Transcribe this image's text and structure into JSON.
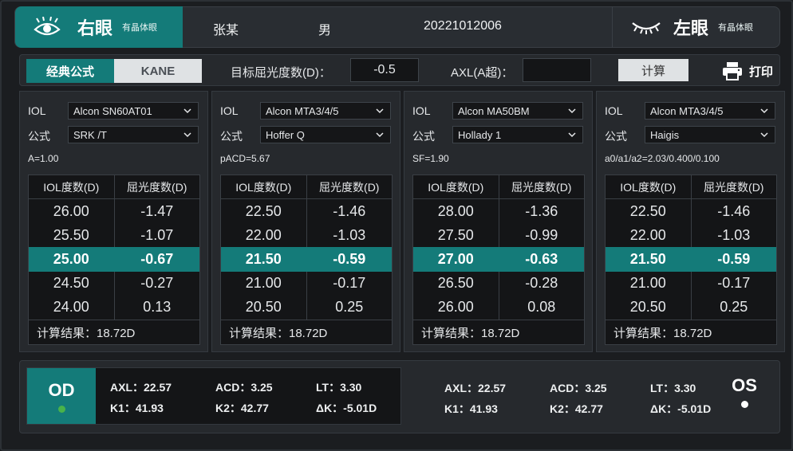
{
  "header": {
    "right_eye_label": "右眼",
    "right_eye_sub": "有晶体眼",
    "patient_name": "张某",
    "gender": "男",
    "patient_id": "20221012006",
    "left_eye_label": "左眼",
    "left_eye_sub": "有晶体眼"
  },
  "toolbar": {
    "tab_classic": "经典公式",
    "tab_kane": "KANE",
    "target_label": "目标屈光度数(D)：",
    "target_value": "-0.5",
    "axl_label": "AXL(A超)：",
    "axl_value": "",
    "calc_label": "计算",
    "print_label": "打印"
  },
  "cards": [
    {
      "iol_label": "IOL",
      "iol_value": "Alcon SN60AT01",
      "formula_label": "公式",
      "formula_value": "SRK /T",
      "param": "A=1.00",
      "col1": "IOL度数(D)",
      "col2": "屈光度数(D)",
      "rows": [
        {
          "iol": "26.00",
          "ref": "-1.47"
        },
        {
          "iol": "25.50",
          "ref": "-1.07"
        },
        {
          "iol": "25.00",
          "ref": "-0.67"
        },
        {
          "iol": "24.50",
          "ref": "-0.27"
        },
        {
          "iol": "24.00",
          "ref": "0.13"
        }
      ],
      "result": "计算结果：18.72D"
    },
    {
      "iol_label": "IOL",
      "iol_value": "Alcon MTA3/4/5",
      "formula_label": "公式",
      "formula_value": "Hoffer Q",
      "param": "pACD=5.67",
      "col1": "IOL度数(D)",
      "col2": "屈光度数(D)",
      "rows": [
        {
          "iol": "22.50",
          "ref": "-1.46"
        },
        {
          "iol": "22.00",
          "ref": "-1.03"
        },
        {
          "iol": "21.50",
          "ref": "-0.59"
        },
        {
          "iol": "21.00",
          "ref": "-0.17"
        },
        {
          "iol": "20.50",
          "ref": "0.25"
        }
      ],
      "result": "计算结果：18.72D"
    },
    {
      "iol_label": "IOL",
      "iol_value": "Alcon MA50BM",
      "formula_label": "公式",
      "formula_value": "Hollady 1",
      "param": "SF=1.90",
      "col1": "IOL度数(D)",
      "col2": "屈光度数(D)",
      "rows": [
        {
          "iol": "28.00",
          "ref": "-1.36"
        },
        {
          "iol": "27.50",
          "ref": "-0.99"
        },
        {
          "iol": "27.00",
          "ref": "-0.63"
        },
        {
          "iol": "26.50",
          "ref": "-0.28"
        },
        {
          "iol": "26.00",
          "ref": "0.08"
        }
      ],
      "result": "计算结果：18.72D"
    },
    {
      "iol_label": "IOL",
      "iol_value": "Alcon MTA3/4/5",
      "formula_label": "公式",
      "formula_value": "Haigis",
      "param": "a0/a1/a2=2.03/0.400/0.100",
      "col1": "IOL度数(D)",
      "col2": "屈光度数(D)",
      "rows": [
        {
          "iol": "22.50",
          "ref": "-1.46"
        },
        {
          "iol": "22.00",
          "ref": "-1.03"
        },
        {
          "iol": "21.50",
          "ref": "-0.59"
        },
        {
          "iol": "21.00",
          "ref": "-0.17"
        },
        {
          "iol": "20.50",
          "ref": "0.25"
        }
      ],
      "result": "计算结果：18.72D"
    }
  ],
  "od": {
    "label": "OD",
    "axl": "AXL：22.57",
    "acd": "ACD：3.25",
    "lt": "LT：3.30",
    "k1": "K1：41.93",
    "k2": "K2：42.77",
    "dk": "ΔK：-5.01D"
  },
  "os": {
    "label": "OS",
    "axl": "AXL：22.57",
    "acd": "ACD：3.25",
    "lt": "LT：3.30",
    "k1": "K1：41.93",
    "k2": "K2：42.77",
    "dk": "ΔK：-5.01D"
  },
  "colors": {
    "accent": "#147b79",
    "background": "#1b1d20",
    "panel": "#26292d",
    "od_indicator": "#49b34a"
  }
}
